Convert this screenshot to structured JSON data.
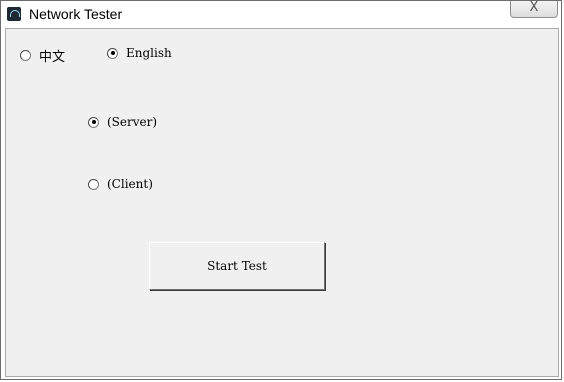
{
  "window": {
    "title": "Network Tester",
    "close_label": "X"
  },
  "language": {
    "options": [
      {
        "label": "中文",
        "checked": false
      },
      {
        "label": "English",
        "checked": true
      }
    ]
  },
  "mode": {
    "options": [
      {
        "label": "(Server)",
        "checked": true
      },
      {
        "label": "(Client)",
        "checked": false
      }
    ]
  },
  "actions": {
    "start_label": "Start Test"
  }
}
